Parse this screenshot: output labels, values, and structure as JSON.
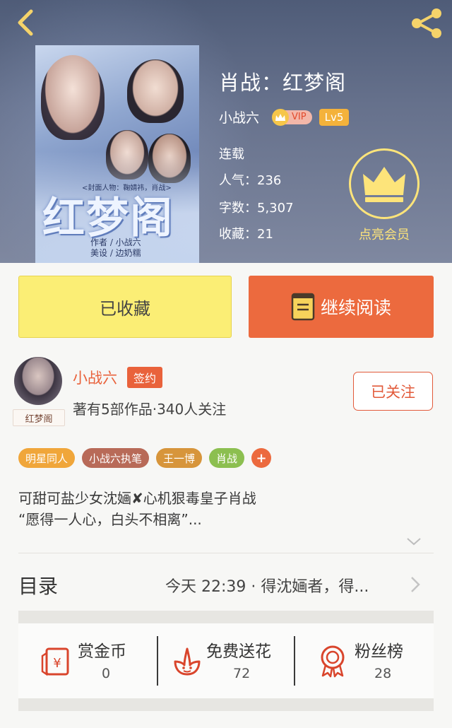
{
  "book": {
    "title": "肖战：红梦阁",
    "author": "小战六",
    "vip_label": "VIP",
    "level": "Lv5",
    "status": "连载",
    "popularity": "人气：236",
    "word_count": "字数：5,307",
    "favorites": "收藏：21",
    "cover": {
      "title_art": "红梦阁",
      "tag_line": "<封面人物：鞠婧祎，肖战>",
      "credit_author": "作者 / 小战六",
      "credit_design": "美设 / 边奶糯"
    }
  },
  "member": {
    "label": "点亮会员"
  },
  "actions": {
    "collected_label": "已收藏",
    "continue_label": "继续阅读"
  },
  "author_card": {
    "name": "小战六",
    "sign_badge": "签约",
    "stats": "著有5部作品·340人关注",
    "avatar_tag": "红梦阁",
    "follow_label": "已关注"
  },
  "tags": [
    {
      "label": "明星同人",
      "color": "#f0a63a"
    },
    {
      "label": "小战六执笔",
      "color": "#b86a58"
    },
    {
      "label": "王一博",
      "color": "#d7953b"
    },
    {
      "label": "肖战",
      "color": "#8cbf50"
    }
  ],
  "tag_add": "+",
  "description": {
    "line1": "可甜可盐少女沈婳✘心机狠毒皇子肖战",
    "line2": "“愿得一人心，白头不相离”..."
  },
  "catalog": {
    "title": "目录",
    "latest": "今天 22:39 · 得沈婳者，得..."
  },
  "rewards": [
    {
      "label": "赏金币",
      "value": "0",
      "icon": "red-envelope-icon"
    },
    {
      "label": "免费送花",
      "value": "72",
      "icon": "flower-icon"
    },
    {
      "label": "粉丝榜",
      "value": "28",
      "icon": "medal-icon"
    }
  ],
  "colors": {
    "accent_orange": "#ec6a3e",
    "collected_yellow": "#fbee75",
    "member_yellow": "#fde47a",
    "icon_red": "#d9452c"
  }
}
